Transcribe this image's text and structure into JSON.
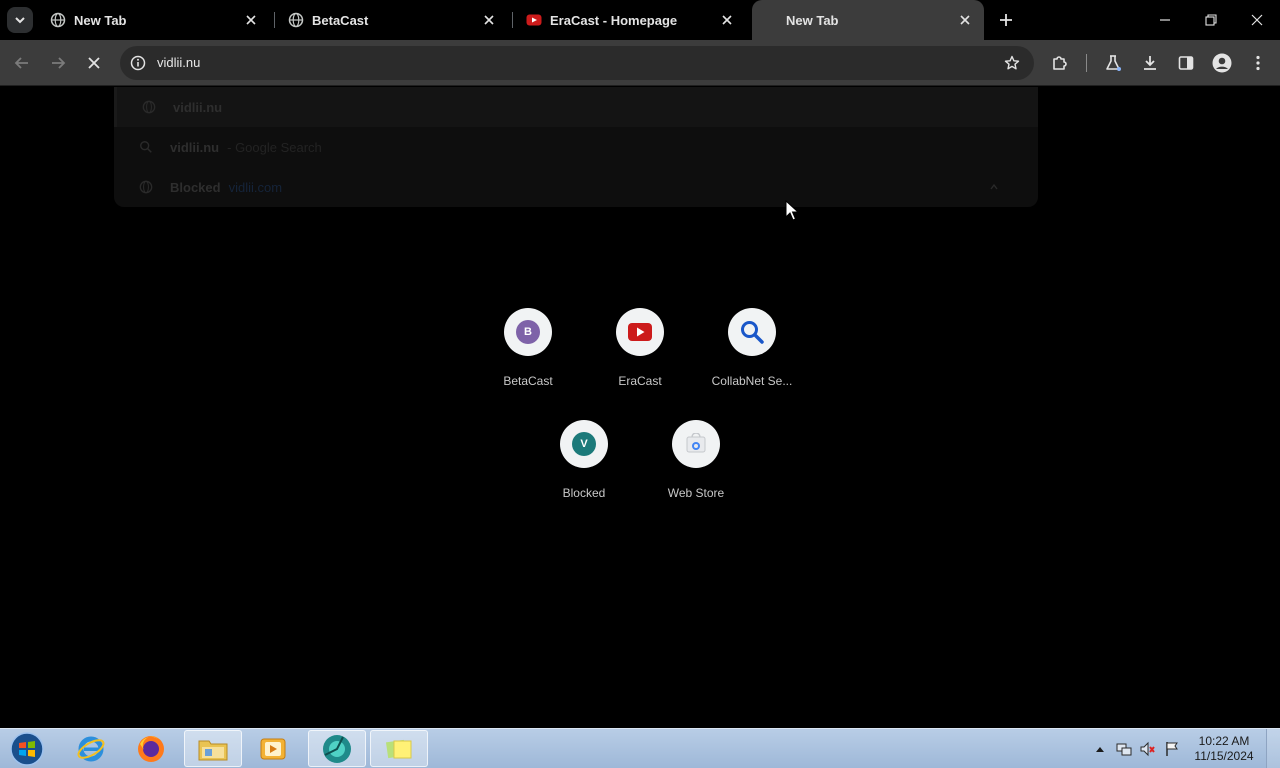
{
  "tabs": [
    {
      "title": "New Tab",
      "favicon": "globe-icon"
    },
    {
      "title": "BetaCast",
      "favicon": "globe-icon"
    },
    {
      "title": "EraCast - Homepage",
      "favicon": "play-icon"
    },
    {
      "title": "New Tab",
      "favicon": "none",
      "active": true
    }
  ],
  "omnibox": {
    "value": "vidlii.nu"
  },
  "suggestions": [
    {
      "main": "vidlii.nu",
      "sub": "",
      "url": ""
    },
    {
      "main": "vidlii.nu",
      "sub": "- Google Search",
      "url": ""
    },
    {
      "main": "Blocked",
      "sub": "",
      "url": "vidlii.com"
    }
  ],
  "shortcuts": [
    {
      "label": "BetaCast",
      "letter": "B",
      "color": "#7e62a8",
      "kind": "letter"
    },
    {
      "label": "EraCast",
      "letter": "",
      "color": "#cc1b1b",
      "kind": "play"
    },
    {
      "label": "CollabNet Se...",
      "letter": "",
      "color": "#1a73e8",
      "kind": "search"
    },
    {
      "label": "Blocked",
      "letter": "V",
      "color": "#1c7a7a",
      "kind": "letter"
    },
    {
      "label": "Web Store",
      "letter": "",
      "color": "#4285f4",
      "kind": "store"
    }
  ],
  "taskbar": {
    "time": "10:22 AM",
    "date": "11/15/2024"
  },
  "colors": {
    "toolbar": "#3c3c3c",
    "omnibox": "#2b2b2b",
    "page_bg": "#000000",
    "taskbar": "#aec4e0"
  }
}
